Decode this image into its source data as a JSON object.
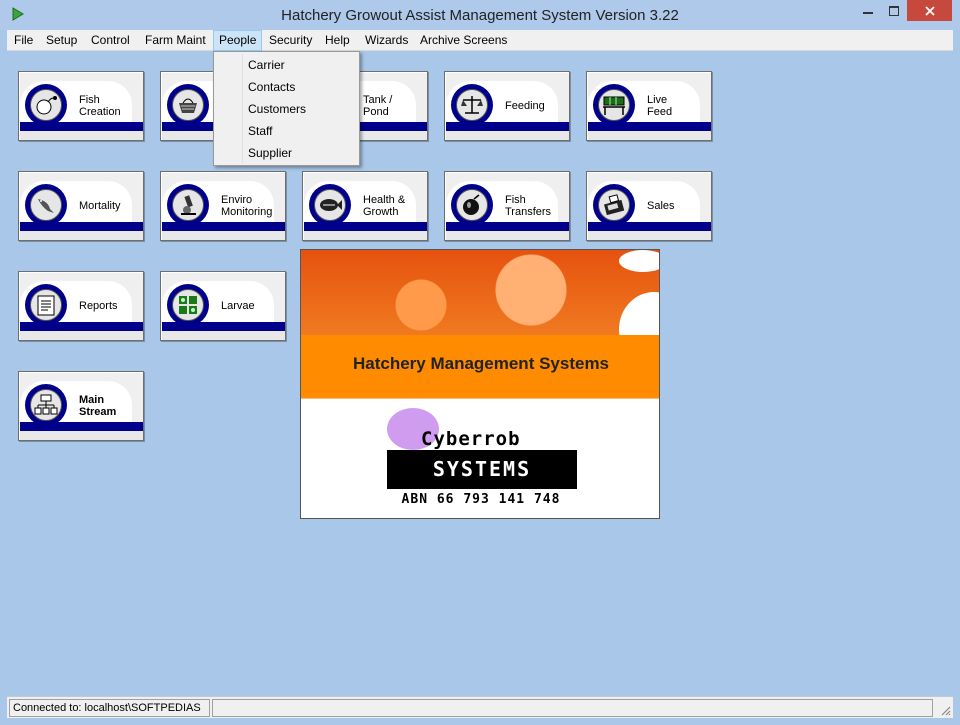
{
  "window": {
    "title": "Hatchery Growout Assist Management System Version 3.22"
  },
  "menu": {
    "items": [
      "File",
      "Setup",
      "Control",
      "Farm Maint",
      "People",
      "Security",
      "Help",
      "Wizards",
      "Archive Screens"
    ],
    "active": "People"
  },
  "people_menu": {
    "items": [
      "Carrier",
      "Contacts",
      "Customers",
      "Staff",
      "Supplier"
    ]
  },
  "tiles": {
    "fish_creation": "Fish\nCreation",
    "tank_pond": "Tank  /\nPond",
    "feeding": "Feeding",
    "live_feed": "Live\nFeed",
    "mortality": "Mortality",
    "enviro_monitoring": "Enviro\nMonitoring",
    "health_growth": "Health &\nGrowth",
    "fish_transfers": "Fish\nTransfers",
    "sales": "Sales",
    "reports": "Reports",
    "larvae": "Larvae",
    "main_stream": "Main\nStream"
  },
  "splash": {
    "heading": "Hatchery Management Systems",
    "brand": "Cyberrob",
    "systems": "SYSTEMS",
    "abn": "ABN 66 793 141 748"
  },
  "status": {
    "connection": "Connected to: localhost\\SOFTPEDIAS"
  },
  "colors": {
    "desktop": "#a9c7e9",
    "tile_band": "#00008b",
    "splash_orange": "#ff8c00",
    "close_button": "#c7483c"
  },
  "icons": [
    "app-icon",
    "minimize-icon",
    "maximize-icon",
    "close-icon",
    "fish-egg-icon",
    "basket-icon",
    "scales-icon",
    "aquarium-icon",
    "dead-fish-icon",
    "microscope-icon",
    "fish-icon",
    "fish-bowl-icon",
    "cash-register-icon",
    "report-icon",
    "larvae-icon",
    "org-chart-icon"
  ]
}
